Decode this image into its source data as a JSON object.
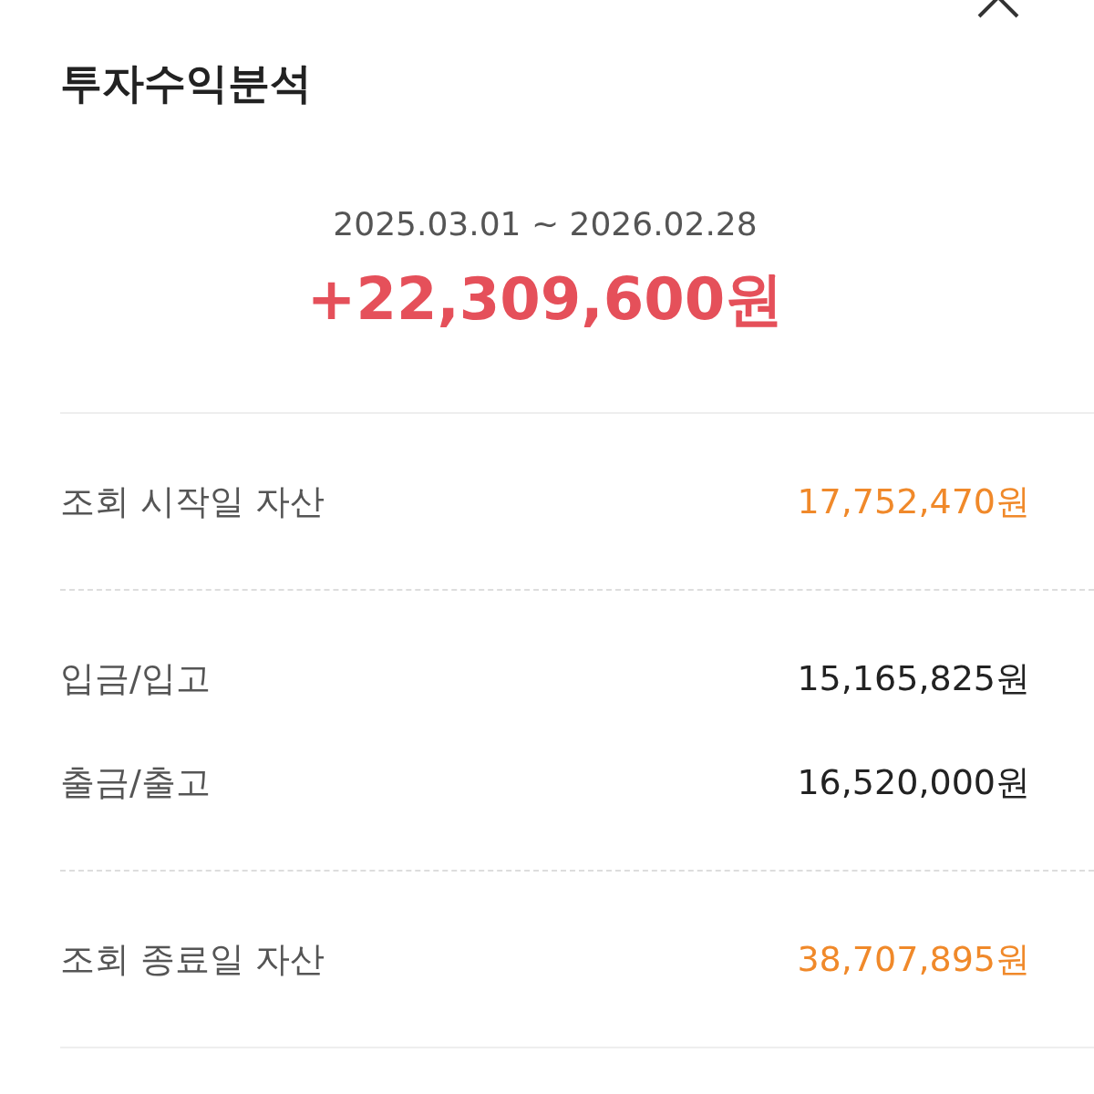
{
  "title": "투자수익분석",
  "period": {
    "start": "2025.03.01",
    "separator": "~",
    "end": "2026.02.28"
  },
  "total_profit": "+22,309,600원",
  "groups": [
    {
      "rows": [
        {
          "label": "조회 시작일 자산",
          "value": "17,752,470원",
          "kind": "highlight"
        }
      ]
    },
    {
      "rows": [
        {
          "label": "입금/입고",
          "value": "15,165,825원",
          "kind": "normal"
        },
        {
          "label": "출금/출고",
          "value": "16,520,000원",
          "kind": "normal"
        }
      ]
    },
    {
      "rows": [
        {
          "label": "조회 종료일 자산",
          "value": "38,707,895원",
          "kind": "highlight"
        }
      ]
    }
  ]
}
